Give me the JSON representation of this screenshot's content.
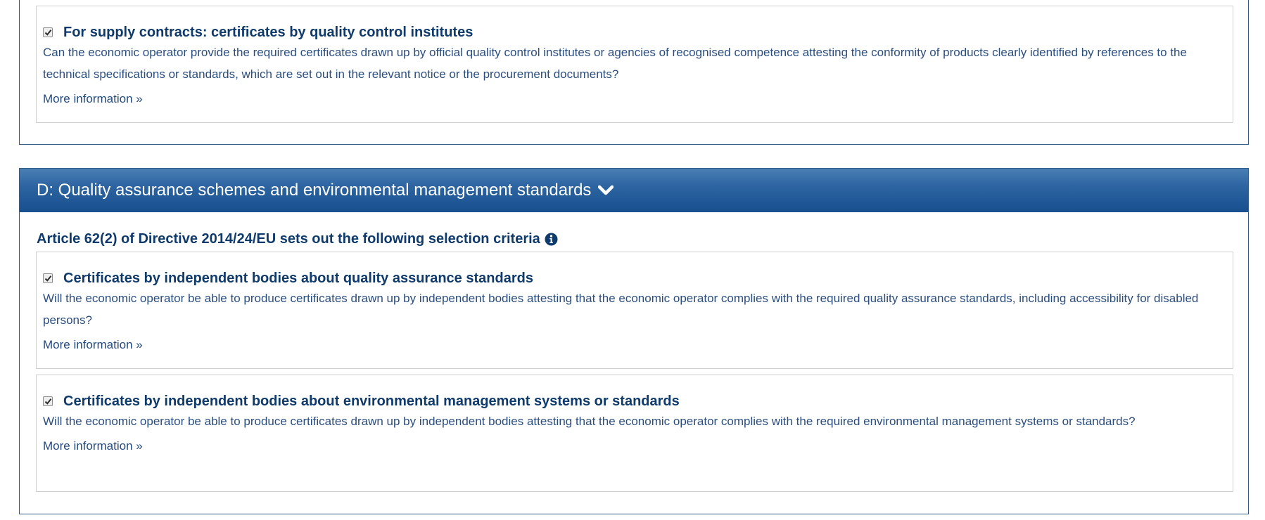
{
  "section_c": {
    "criterion_supply": {
      "checked": true,
      "title": "For supply contracts: certificates by quality control institutes",
      "description": "Can the economic operator provide the required certificates drawn up by official quality control institutes or agencies of recognised competence attesting the conformity of products clearly identified by references to the technical specifications or standards, which are set out in the relevant notice or the procurement documents?",
      "more_info": "More information »"
    }
  },
  "section_d": {
    "header_title": "D: Quality assurance schemes and environmental management standards",
    "header_icon": "chevron-down-icon",
    "article_text": "Article 62(2) of Directive 2014/24/EU sets out the following selection criteria",
    "article_icon": "info-circle-icon",
    "criteria": [
      {
        "checked": true,
        "title": "Certificates by independent bodies about quality assurance standards",
        "description": "Will the economic operator be able to produce certificates drawn up by independent bodies attesting that the economic operator complies with the required quality assurance standards, including accessibility for disabled persons?",
        "more_info": "More information »"
      },
      {
        "checked": true,
        "title": "Certificates by independent bodies about environmental management systems or standards",
        "description": "Will the economic operator be able to produce certificates drawn up by independent bodies attesting that the economic operator complies with the required environmental management systems or standards?",
        "more_info": "More information »"
      }
    ]
  },
  "colors": {
    "title_text": "#0e3a6c",
    "body_text": "#2a4e80",
    "header_gradient_top": "#4a7fb5",
    "header_gradient_bottom": "#174f8f",
    "panel_border": "#335b87"
  }
}
